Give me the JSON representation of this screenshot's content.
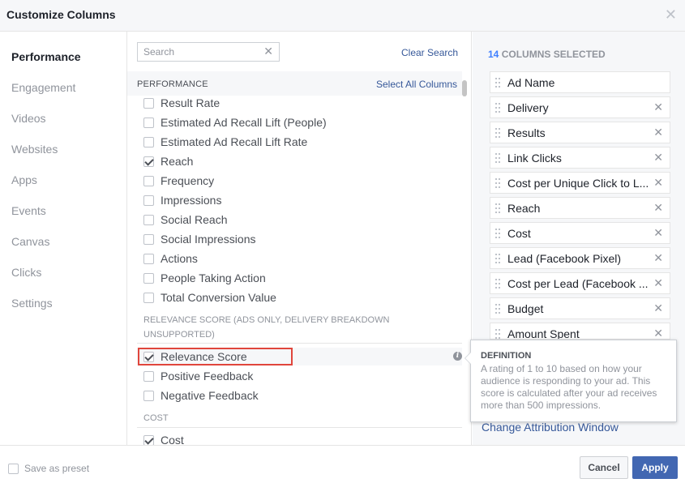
{
  "dialog": {
    "title": "Customize Columns"
  },
  "nav": {
    "items": [
      "Performance",
      "Engagement",
      "Videos",
      "Websites",
      "Apps",
      "Events",
      "Canvas",
      "Clicks",
      "Settings"
    ]
  },
  "search": {
    "placeholder": "Search",
    "clear_label": "Clear Search"
  },
  "section": {
    "title": "PERFORMANCE",
    "select_all": "Select All Columns"
  },
  "options_a": [
    {
      "label": "Result Rate",
      "checked": false
    },
    {
      "label": "Estimated Ad Recall Lift (People)",
      "checked": false
    },
    {
      "label": "Estimated Ad Recall Lift Rate",
      "checked": false
    },
    {
      "label": "Reach",
      "checked": true
    },
    {
      "label": "Frequency",
      "checked": false
    },
    {
      "label": "Impressions",
      "checked": false
    },
    {
      "label": "Social Reach",
      "checked": false
    },
    {
      "label": "Social Impressions",
      "checked": false
    },
    {
      "label": "Actions",
      "checked": false
    },
    {
      "label": "People Taking Action",
      "checked": false
    },
    {
      "label": "Total Conversion Value",
      "checked": false
    }
  ],
  "relevance_group": {
    "title_line1": "RELEVANCE SCORE (ADS ONLY, DELIVERY BREAKDOWN",
    "title_line2": "UNSUPPORTED)",
    "options": [
      {
        "label": "Relevance Score",
        "checked": true
      },
      {
        "label": "Positive Feedback",
        "checked": false
      },
      {
        "label": "Negative Feedback",
        "checked": false
      }
    ]
  },
  "cost_group": {
    "title": "COST",
    "options": [
      {
        "label": "Cost",
        "checked": true
      }
    ]
  },
  "selected": {
    "count": "14",
    "count_label": "COLUMNS SELECTED",
    "columns": [
      "Ad Name",
      "Delivery",
      "Results",
      "Link Clicks",
      "Cost per Unique Click to L...",
      "Reach",
      "Cost",
      "Lead (Facebook Pixel)",
      "Cost per Lead (Facebook ...",
      "Budget",
      "Amount Spent"
    ],
    "change_attribution": "Change Attribution Window"
  },
  "tooltip": {
    "title": "DEFINITION",
    "body": "A rating of 1 to 10 based on how your audience is responding to your ad. This score is calculated after your ad receives more than 500 impressions."
  },
  "footer": {
    "save_preset": "Save as preset",
    "cancel": "Cancel",
    "apply": "Apply"
  },
  "colors": {
    "accent": "#4267b2",
    "link": "#365899",
    "highlight_border": "#e0463c",
    "count_blue": "#4080ff"
  },
  "icons": {
    "close": "close-icon",
    "clear_search": "clear-icon",
    "drag_handle": "drag-handle-icon",
    "remove": "remove-icon",
    "info": "info-icon",
    "check": "checkmark-icon"
  }
}
